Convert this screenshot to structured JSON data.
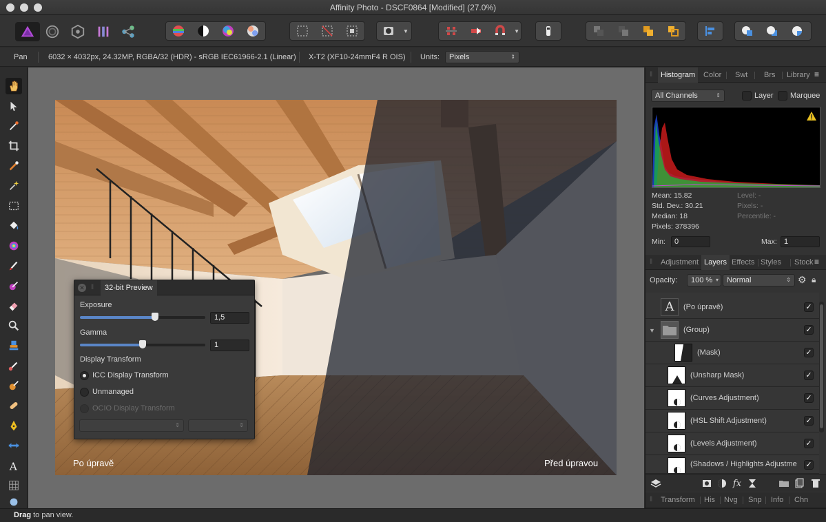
{
  "window": {
    "title": "Affinity Photo - DSCF0864 [Modified] (27.0%)"
  },
  "toolbar": {
    "personas": [
      "photo-persona-icon",
      "liquify-persona-icon",
      "develop-persona-icon",
      "tone-mapping-persona-icon",
      "export-persona-icon"
    ],
    "auto_buttons": [
      "auto-levels-icon",
      "auto-contrast-icon",
      "auto-colors-icon",
      "auto-white-balance-icon"
    ],
    "selection_buttons": [
      "select-all-icon",
      "deselect-icon",
      "invert-selection-icon"
    ],
    "quick_mask_icon": "quick-mask-icon",
    "snap_buttons": [
      "force-pixel-alignment-icon",
      "move-by-whole-pixels-icon",
      "snapping-icon"
    ],
    "assistant_icon": "assistant-icon",
    "arrange_buttons": [
      "move-to-back-icon",
      "move-back-one-icon",
      "move-forward-one-icon",
      "move-to-front-icon"
    ],
    "align_icon": "align-icon",
    "boolean_buttons": [
      "add-icon",
      "subtract-icon",
      "intersect-icon"
    ]
  },
  "context": {
    "tool_name": "Pan",
    "doc_info": "6032 × 4032px, 24.32MP, RGBA/32 (HDR) - sRGB IEC61966-2.1 (Linear)",
    "camera": "X-T2 (XF10-24mmF4 R OIS)",
    "units_label": "Units:",
    "units_value": "Pixels"
  },
  "tools": [
    "hand-tool-icon",
    "move-tool-icon",
    "color-picker-icon",
    "crop-tool-icon",
    "selection-brush-icon",
    "flood-select-icon",
    "marquee-tool-icon",
    "fill-tool-icon",
    "gradient-tool-icon",
    "paint-brush-icon",
    "color-replacement-icon",
    "erase-brush-icon",
    "dodge-brush-icon",
    "clone-brush-icon",
    "smudge-brush-icon",
    "healing-brush-icon",
    "pen-tool-icon",
    "mesh-warp-icon",
    "text-tool-icon",
    "perspective-tool-icon",
    "zoom-tool-icon"
  ],
  "canvas": {
    "caption_left": "Po úpravě",
    "caption_right": "Před úpravou"
  },
  "preview_panel": {
    "title": "32-bit Preview",
    "exposure_label": "Exposure",
    "exposure_value": "1,5",
    "exposure_level": 0.6,
    "gamma_label": "Gamma",
    "gamma_value": "1",
    "gamma_level": 0.5,
    "display_transform_label": "Display Transform",
    "options": [
      {
        "label": "ICC Display Transform",
        "selected": true,
        "enabled": true
      },
      {
        "label": "Unmanaged",
        "selected": false,
        "enabled": true
      },
      {
        "label": "OCIO Display Transform",
        "selected": false,
        "enabled": false
      }
    ]
  },
  "histogram_panel": {
    "tabs": [
      "Histogram",
      "Color",
      "Swt",
      "Brs",
      "Library"
    ],
    "active_tab": "Histogram",
    "channels": "All Channels",
    "layer_label": "Layer",
    "marquee_label": "Marquee",
    "stats_left": [
      "Mean: 15.82",
      "Std. Dev.: 30.21",
      "Median: 18",
      "Pixels: 378396"
    ],
    "stats_right": [
      "Level: -",
      "Pixels: -",
      "Percentile: -"
    ],
    "min_label": "Min:",
    "min_value": "0",
    "max_label": "Max:",
    "max_value": "1",
    "warning_icon": "warning-icon"
  },
  "layers_panel": {
    "tabs": [
      "Adjustment",
      "Layers",
      "Effects",
      "Styles",
      "Stock"
    ],
    "active_tab": "Layers",
    "opacity_label": "Opacity:",
    "opacity_value": "100 %",
    "blend_mode": "Normal",
    "layers": [
      {
        "name": "(Po úpravě)",
        "kind": "text",
        "indent": 0
      },
      {
        "name": "(Group)",
        "kind": "group",
        "indent": 0
      },
      {
        "name": "(Mask)",
        "kind": "mask",
        "indent": 1
      },
      {
        "name": "(Unsharp Mask)",
        "kind": "filter",
        "indent": 0
      },
      {
        "name": "(Curves Adjustment)",
        "kind": "adjustment",
        "indent": 0
      },
      {
        "name": "(HSL Shift Adjustment)",
        "kind": "adjustment",
        "indent": 0
      },
      {
        "name": "(Levels Adjustment)",
        "kind": "adjustment",
        "indent": 0
      },
      {
        "name": "(Shadows / Highlights Adjustme",
        "kind": "adjustment",
        "indent": 0
      }
    ],
    "footer_icons": [
      "layers-stack-icon",
      "mask-layer-icon",
      "adjustment-icon",
      "fx-icon",
      "live-filter-icon",
      "new-group-icon",
      "new-pixel-layer-icon",
      "delete-layer-icon"
    ]
  },
  "bottom_tabs": [
    "Transform",
    "His",
    "Nvg",
    "Snp",
    "Info",
    "Chn"
  ],
  "status": {
    "bold": "Drag",
    "rest": " to pan view."
  },
  "colors": {
    "accent": "#5a86c8",
    "panel": "#333333",
    "canvas_bg": "#6c6c6c"
  }
}
